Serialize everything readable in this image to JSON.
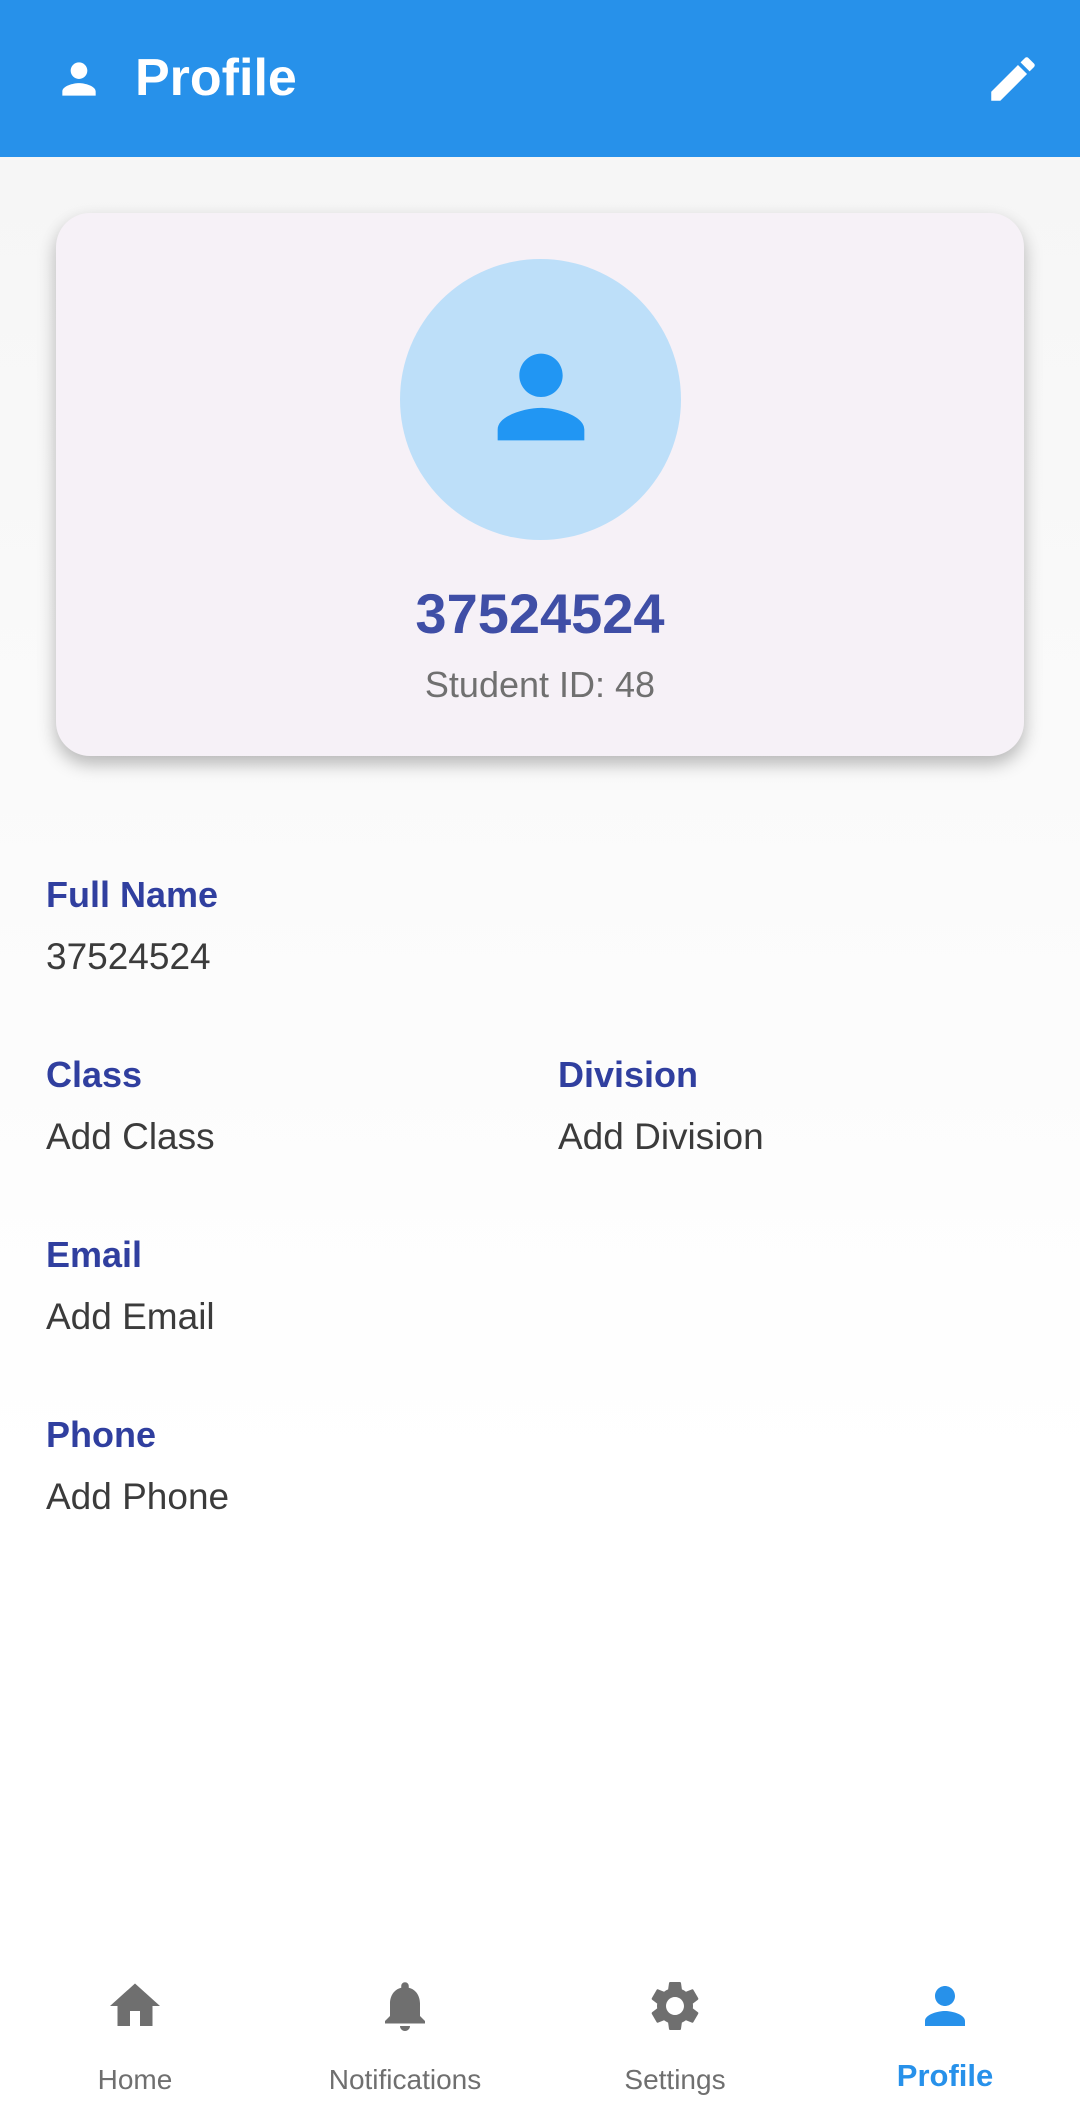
{
  "appbar": {
    "title": "Profile",
    "icon": "person-icon",
    "edit_icon": "edit-pencil-icon"
  },
  "card": {
    "name": "37524524",
    "student_id": "Student ID: 48",
    "avatar_icon": "person-icon"
  },
  "fields": {
    "full_name": {
      "label": "Full Name",
      "value": "37524524"
    },
    "class": {
      "label": "Class",
      "value": "Add Class"
    },
    "division": {
      "label": "Division",
      "value": "Add Division"
    },
    "email": {
      "label": "Email",
      "value": "Add Email"
    },
    "phone": {
      "label": "Phone",
      "value": "Add Phone"
    }
  },
  "bottom_nav": {
    "items": [
      {
        "label": "Home",
        "icon": "home-icon",
        "active": false
      },
      {
        "label": "Notifications",
        "icon": "bell-icon",
        "active": false
      },
      {
        "label": "Settings",
        "icon": "gear-icon",
        "active": false
      },
      {
        "label": "Profile",
        "icon": "person-icon",
        "active": true
      }
    ]
  },
  "colors": {
    "primary": "#2791ea",
    "label": "#303f9f",
    "card_bg": "#f6f1f7",
    "avatar_bg": "#bddff9",
    "inactive": "#6f6f6f"
  }
}
